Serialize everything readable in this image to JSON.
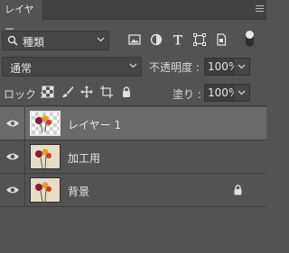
{
  "tab": {
    "label": "レイヤー"
  },
  "filter": {
    "kind_label": "種類"
  },
  "blend": {
    "mode": "通常",
    "opacity_label": "不透明度 :",
    "opacity_value": "100%"
  },
  "lock": {
    "label": "ロック :",
    "fill_label": "塗り :",
    "fill_value": "100%"
  },
  "layers": [
    {
      "name": "レイヤー 1",
      "selected": true,
      "visible": true,
      "locked": false
    },
    {
      "name": "加工用",
      "selected": false,
      "visible": true,
      "locked": false
    },
    {
      "name": "背景",
      "selected": false,
      "visible": true,
      "locked": true
    }
  ],
  "icons": {
    "filter_buttons": [
      "image-filter-icon",
      "adjustment-filter-icon",
      "type-filter-icon",
      "shape-filter-icon",
      "smart-object-filter-icon"
    ],
    "lock_buttons": [
      "lock-transparent-pixels-icon",
      "lock-image-pixels-icon",
      "lock-position-icon",
      "lock-artboard-icon",
      "lock-all-icon"
    ]
  },
  "colors": {
    "panel_bg": "#535353",
    "selected_row": "#6a6a6a",
    "tab_bar": "#424242"
  }
}
